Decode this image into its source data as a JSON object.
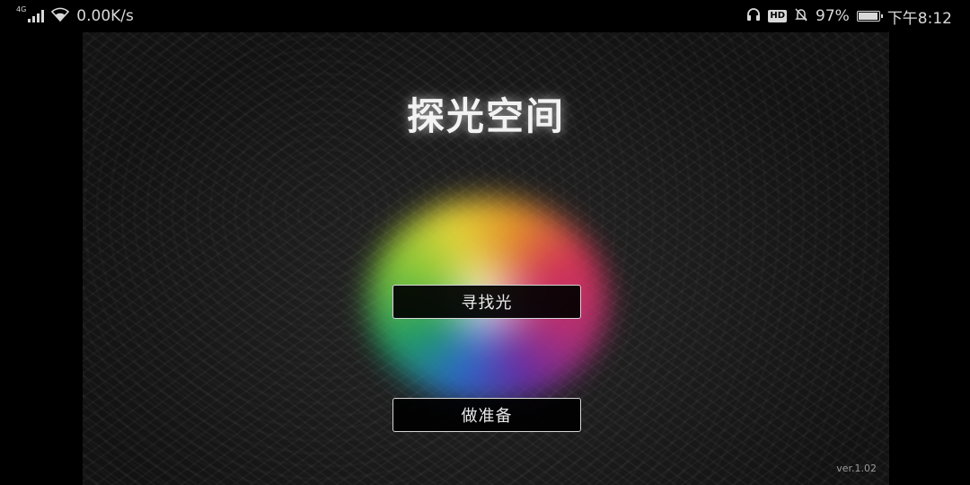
{
  "status_bar": {
    "network_type": "4G",
    "net_speed": "0.00K/s",
    "hd_label": "HD",
    "battery_percent": "97%",
    "battery_level": 0.97,
    "time": "下午8:12"
  },
  "app": {
    "title": "探光空间",
    "buttons": {
      "find_light": "寻找光",
      "prepare": "做准备"
    },
    "version": "ver.1.02"
  },
  "colors": {
    "background": "#000000",
    "stage": "#141414",
    "text": "#f2f2f2",
    "button_border": "#d6d6d6"
  }
}
